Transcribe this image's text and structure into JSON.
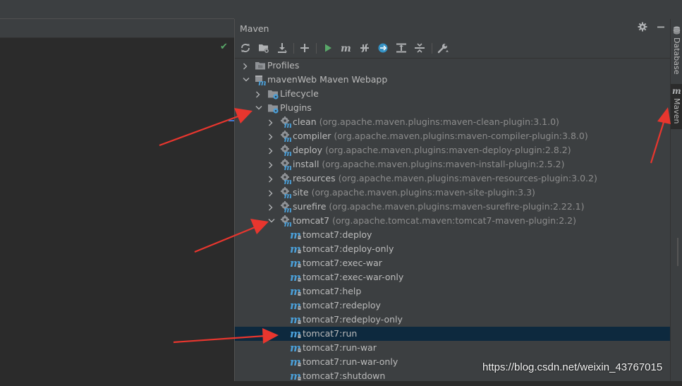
{
  "panel": {
    "title": "Maven",
    "header_buttons": [
      {
        "icon": "gear-icon"
      },
      {
        "icon": "minimize-icon"
      }
    ],
    "toolbar": [
      {
        "name": "reload-icon"
      },
      {
        "name": "generate-sources-icon"
      },
      {
        "name": "download-icon"
      },
      {
        "name": "add-icon"
      },
      {
        "name": "run-icon"
      },
      {
        "name": "execute-goal-icon"
      },
      {
        "name": "toggle-offline-icon"
      },
      {
        "name": "skip-tests-icon"
      },
      {
        "name": "show-dependencies-icon"
      },
      {
        "name": "collapse-all-icon"
      },
      {
        "name": "settings-wrench-icon"
      }
    ]
  },
  "tree": [
    {
      "label": "Profiles",
      "coord": "",
      "level": 0,
      "arrow": "right",
      "icon": "folder"
    },
    {
      "label": "mavenWeb Maven Webapp",
      "coord": "",
      "level": 0,
      "arrow": "down",
      "icon": "maven-project"
    },
    {
      "label": "Lifecycle",
      "coord": "",
      "level": 1,
      "arrow": "right",
      "icon": "folder-gear"
    },
    {
      "label": "Plugins",
      "coord": "",
      "level": 1,
      "arrow": "down",
      "icon": "folder-gear"
    },
    {
      "label": "clean",
      "coord": "(org.apache.maven.plugins:maven-clean-plugin:3.1.0)",
      "level": 2,
      "arrow": "right",
      "icon": "plugin"
    },
    {
      "label": "compiler",
      "coord": "(org.apache.maven.plugins:maven-compiler-plugin:3.8.0)",
      "level": 2,
      "arrow": "right",
      "icon": "plugin"
    },
    {
      "label": "deploy",
      "coord": "(org.apache.maven.plugins:maven-deploy-plugin:2.8.2)",
      "level": 2,
      "arrow": "right",
      "icon": "plugin"
    },
    {
      "label": "install",
      "coord": "(org.apache.maven.plugins:maven-install-plugin:2.5.2)",
      "level": 2,
      "arrow": "right",
      "icon": "plugin"
    },
    {
      "label": "resources",
      "coord": "(org.apache.maven.plugins:maven-resources-plugin:3.0.2)",
      "level": 2,
      "arrow": "right",
      "icon": "plugin"
    },
    {
      "label": "site",
      "coord": "(org.apache.maven.plugins:maven-site-plugin:3.3)",
      "level": 2,
      "arrow": "right",
      "icon": "plugin"
    },
    {
      "label": "surefire",
      "coord": "(org.apache.maven.plugins:maven-surefire-plugin:2.22.1)",
      "level": 2,
      "arrow": "right",
      "icon": "plugin"
    },
    {
      "label": "tomcat7",
      "coord": "(org.apache.tomcat.maven:tomcat7-maven-plugin:2.2)",
      "level": 2,
      "arrow": "down",
      "icon": "plugin"
    },
    {
      "label": "tomcat7:deploy",
      "coord": "",
      "level": 3,
      "arrow": "none",
      "icon": "goal"
    },
    {
      "label": "tomcat7:deploy-only",
      "coord": "",
      "level": 3,
      "arrow": "none",
      "icon": "goal"
    },
    {
      "label": "tomcat7:exec-war",
      "coord": "",
      "level": 3,
      "arrow": "none",
      "icon": "goal"
    },
    {
      "label": "tomcat7:exec-war-only",
      "coord": "",
      "level": 3,
      "arrow": "none",
      "icon": "goal"
    },
    {
      "label": "tomcat7:help",
      "coord": "",
      "level": 3,
      "arrow": "none",
      "icon": "goal"
    },
    {
      "label": "tomcat7:redeploy",
      "coord": "",
      "level": 3,
      "arrow": "none",
      "icon": "goal"
    },
    {
      "label": "tomcat7:redeploy-only",
      "coord": "",
      "level": 3,
      "arrow": "none",
      "icon": "goal"
    },
    {
      "label": "tomcat7:run",
      "coord": "",
      "level": 3,
      "arrow": "none",
      "icon": "goal",
      "selected": true
    },
    {
      "label": "tomcat7:run-war",
      "coord": "",
      "level": 3,
      "arrow": "none",
      "icon": "goal"
    },
    {
      "label": "tomcat7:run-war-only",
      "coord": "",
      "level": 3,
      "arrow": "none",
      "icon": "goal"
    },
    {
      "label": "tomcat7:shutdown",
      "coord": "",
      "level": 3,
      "arrow": "none",
      "icon": "goal"
    }
  ],
  "side_stripe": [
    {
      "label": "Database",
      "icon": "database-icon",
      "active": false
    },
    {
      "label": "Maven",
      "icon": "maven-m-icon",
      "active": true
    }
  ],
  "watermark": "https://blog.csdn.net/weixin_43767015",
  "colors": {
    "panel_bg": "#3c3f41",
    "editor_bg": "#2b2b2b",
    "selection": "#0d293e",
    "text": "#bbbbbb",
    "coord_text": "#8c8c8c",
    "maven_blue": "#4a9fd8",
    "run_green": "#59a869",
    "annotation_red": "#e8362e"
  }
}
